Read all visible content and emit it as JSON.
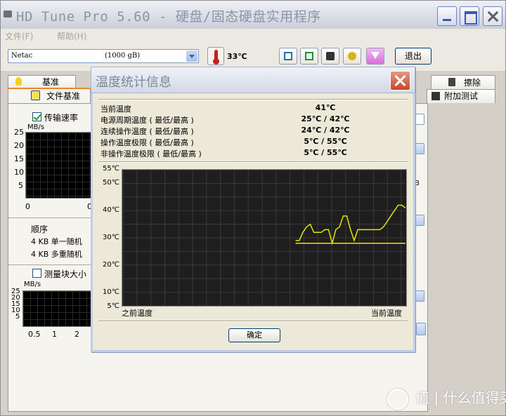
{
  "window": {
    "title": "HD Tune Pro 5.60 - 硬盘/固态硬盘实用程序"
  },
  "menu": [
    "文件(F)",
    "帮助(H)"
  ],
  "toolbar": {
    "drive_name": "Netac",
    "drive_size": "(1000 gB)",
    "temperature": "33℃",
    "exit_label": "退出"
  },
  "tabs": {
    "row1_left": "基准",
    "row1_right": "擦除",
    "row2_left": "文件基准",
    "row2_right": "附加测试"
  },
  "left_panel": {
    "transfer_rate_label": "传输速率",
    "transfer_unit": "MB/s",
    "y_ticks_top": [
      "25",
      "20",
      "15",
      "10",
      "5"
    ],
    "x_ticks_top": [
      "0",
      "0"
    ],
    "order_label": "顺序",
    "random_single": "4 KB 单一随机",
    "random_multi": "4 KB 多重随机",
    "block_size_label": "测量块大小",
    "block_unit": "MB/s",
    "y_ticks_bottom": [
      "25",
      "20",
      "15",
      "10",
      "5"
    ],
    "x_ticks_bottom": [
      "0.5",
      "1",
      "2"
    ],
    "right_fragment": "B"
  },
  "dialog": {
    "title": "温度统计信息",
    "stats": [
      {
        "label": "当前温度",
        "value": "41℃"
      },
      {
        "label": "电源周期温度 ( 最低/最高 )",
        "value": "25℃ / 42℃"
      },
      {
        "label": "连续操作温度 ( 最低/最高 )",
        "value": "24℃ / 42℃"
      },
      {
        "label": "操作温度极限 ( 最低/最高 )",
        "value": "5℃ / 55℃"
      },
      {
        "label": "非操作温度极限 ( 最低/最高 )",
        "value": "5℃ / 55℃"
      }
    ],
    "ok_label": "确定"
  },
  "chart_data": {
    "type": "line",
    "y_ticks": [
      "55℃",
      "50℃",
      "40℃",
      "30℃",
      "20℃",
      "10℃",
      "5℃"
    ],
    "ylim": [
      5,
      55
    ],
    "x_start_label": "之前温度",
    "x_end_label": "当前温度",
    "series": [
      {
        "values": [
          29,
          29,
          32,
          34,
          35,
          32,
          32,
          32,
          33,
          33,
          28,
          33,
          34,
          38,
          38,
          33,
          29,
          33,
          33,
          33,
          33,
          33,
          33,
          33,
          34,
          36,
          38,
          40,
          42,
          42,
          41
        ]
      },
      {
        "values": [
          28,
          28,
          28,
          28,
          28,
          28,
          28,
          28,
          28,
          28,
          28,
          28,
          28,
          28,
          28,
          28,
          28,
          28,
          28,
          28,
          28,
          28,
          28,
          28,
          28,
          28,
          28,
          28,
          28,
          28,
          28
        ]
      }
    ],
    "color": "#e6e600",
    "grid": true
  },
  "watermark": "值 | 什么值得买"
}
